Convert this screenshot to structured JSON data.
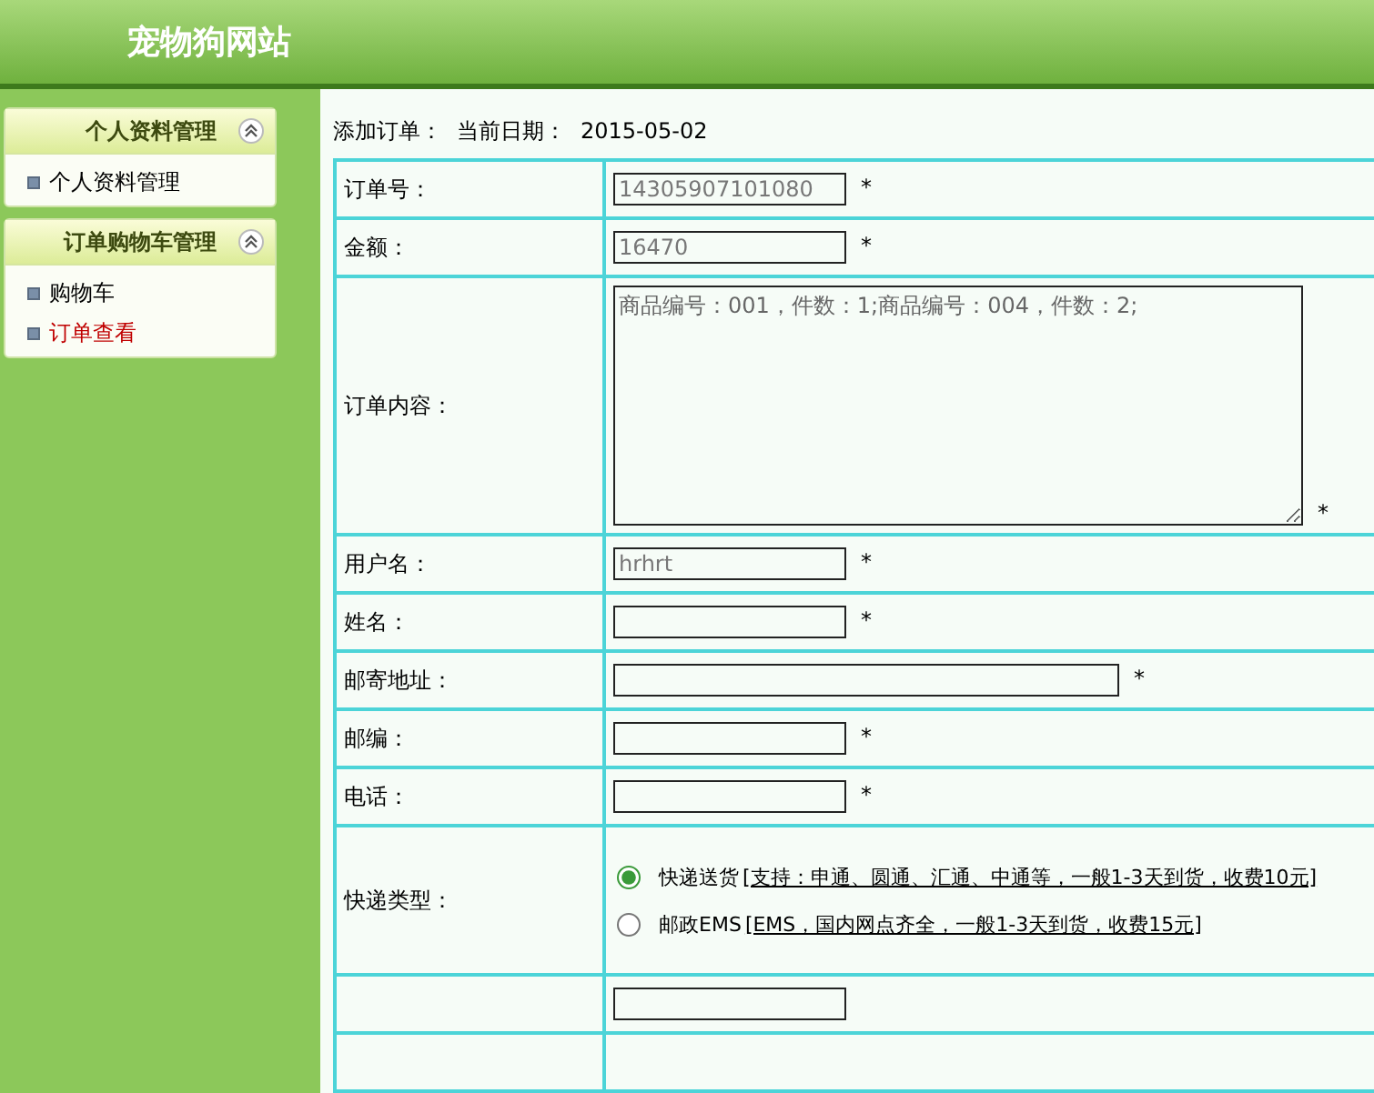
{
  "header": {
    "title": "宠物狗网站"
  },
  "sidebar": {
    "panels": [
      {
        "title": "个人资料管理",
        "items": [
          {
            "label": "个人资料管理",
            "selected": false
          }
        ]
      },
      {
        "title": "订单购物车管理",
        "items": [
          {
            "label": "购物车",
            "selected": false
          },
          {
            "label": "订单查看",
            "selected": true
          }
        ]
      }
    ]
  },
  "page_heading": {
    "title": "添加订单：",
    "date_label": "当前日期：",
    "date": "2015-05-02"
  },
  "form": {
    "rows": [
      {
        "label": "订单号：",
        "kind": "text",
        "value": "14305907101080",
        "mark": "*"
      },
      {
        "label": "金额：",
        "kind": "text",
        "value": "16470",
        "mark": "*"
      },
      {
        "label": "订单内容：",
        "kind": "textarea",
        "value": "商品编号：001，件数：1;商品编号：004，件数：2;",
        "mark": "*"
      },
      {
        "label": "用户名：",
        "kind": "text",
        "value": "hrhrt",
        "mark": "*"
      },
      {
        "label": "姓名：",
        "kind": "text",
        "mark": "*"
      },
      {
        "label": "邮寄地址：",
        "kind": "wide_text",
        "mark": "*"
      },
      {
        "label": "邮编：",
        "kind": "text",
        "mark": "*"
      },
      {
        "label": "电话：",
        "kind": "text",
        "mark": "*"
      },
      {
        "label": "快递类型：",
        "kind": "radio",
        "options": [
          {
            "label": "快递送货",
            "note": "[支持：申通、圆通、汇通、中通等，一般1-3天到货，收费10元]",
            "selected": true
          },
          {
            "label": "邮政EMS",
            "note": "[EMS，国内网点齐全，一般1-3天到货，收费15元]",
            "selected": false
          }
        ]
      },
      {
        "kind": "text"
      },
      {
        "kind": "blank"
      }
    ]
  }
}
